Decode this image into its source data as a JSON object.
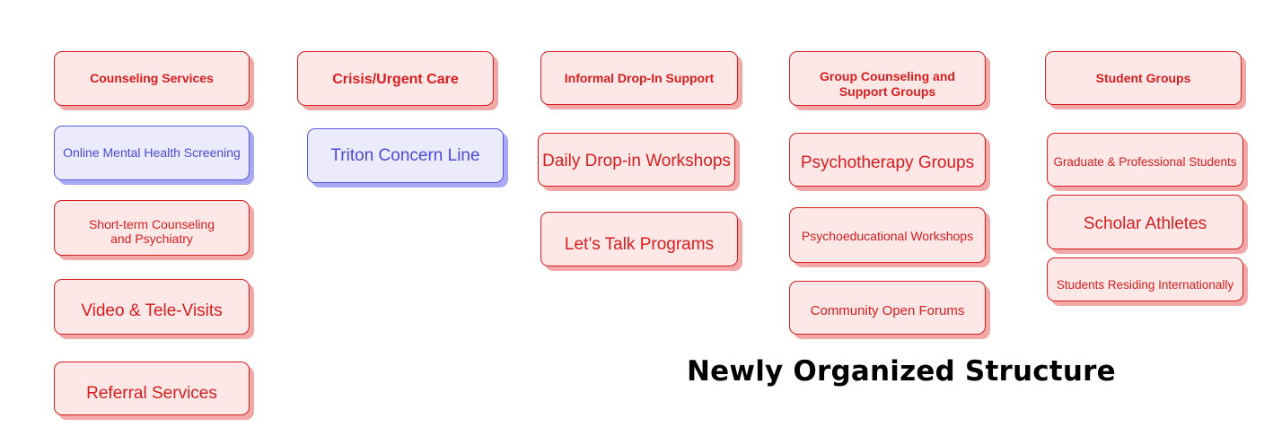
{
  "title": "Newly Organized Structure",
  "colors": {
    "category_text": "#d81e1e",
    "category_fill": "#fde7e7",
    "highlight_text": "#4a4ad6",
    "highlight_fill": "#ebebfd"
  },
  "columns": [
    {
      "header": "Counseling Services",
      "items": [
        "Online Mental Health Screening",
        "Short-term Counseling",
        "and Psychiatry",
        "Video & Tele-Visits",
        "Referral Services"
      ]
    },
    {
      "header": "Crisis/Urgent Care",
      "items": [
        "Triton Concern Line"
      ]
    },
    {
      "header": "Informal Drop-In Support",
      "items": [
        "Daily Drop-in Workshops",
        "Let’s Talk Programs"
      ]
    },
    {
      "header": [
        "Group Counseling and",
        "Support Groups"
      ],
      "items": [
        "Psychotherapy Groups",
        "Psychoeducational Workshops",
        "Community Open Forums"
      ]
    },
    {
      "header": "Student Groups",
      "items": [
        "Graduate & Professional Students",
        "Scholar Athletes",
        "Students Residing Internationally"
      ]
    }
  ]
}
